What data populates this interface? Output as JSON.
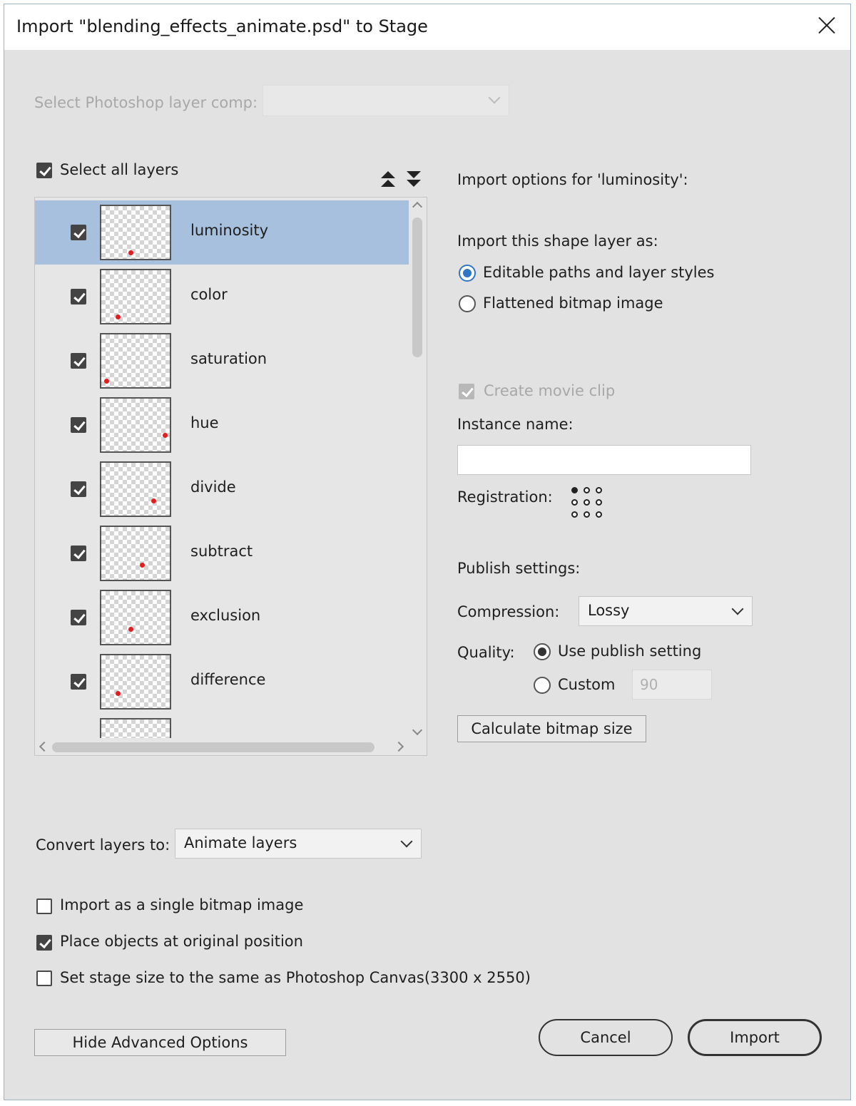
{
  "window": {
    "title": "Import \"blending_effects_animate.psd\" to Stage"
  },
  "layer_comp": {
    "label": "Select Photoshop layer comp:",
    "value": ""
  },
  "select_all": {
    "label": "Select all layers",
    "checked": true
  },
  "layers": [
    {
      "name": "luminosity",
      "checked": true,
      "selected": true
    },
    {
      "name": "color",
      "checked": true,
      "selected": false
    },
    {
      "name": "saturation",
      "checked": true,
      "selected": false
    },
    {
      "name": "hue",
      "checked": true,
      "selected": false
    },
    {
      "name": "divide",
      "checked": true,
      "selected": false
    },
    {
      "name": "subtract",
      "checked": true,
      "selected": false
    },
    {
      "name": "exclusion",
      "checked": true,
      "selected": false
    },
    {
      "name": "difference",
      "checked": true,
      "selected": false
    }
  ],
  "import_options": {
    "heading": "Import options for 'luminosity':",
    "shape_layer_label": "Import this shape layer as:",
    "option_editable": "Editable paths and layer styles",
    "option_flattened": "Flattened bitmap image",
    "create_movie_clip": "Create movie clip",
    "instance_name_label": "Instance name:",
    "instance_name_value": "",
    "registration_label": "Registration:",
    "publish_settings_label": "Publish settings:",
    "compression_label": "Compression:",
    "compression_value": "Lossy",
    "quality_label": "Quality:",
    "quality_publish": "Use publish setting",
    "quality_custom": "Custom",
    "quality_custom_value": "90",
    "calc_button": "Calculate bitmap size"
  },
  "convert": {
    "label": "Convert layers to:",
    "value": "Animate layers"
  },
  "options": {
    "single_bitmap": "Import as a single bitmap image",
    "original_position": "Place objects at original position",
    "stage_size": "Set stage size to the same as Photoshop Canvas(3300 x 2550)"
  },
  "buttons": {
    "hide_advanced": "Hide Advanced Options",
    "cancel": "Cancel",
    "import": "Import"
  }
}
